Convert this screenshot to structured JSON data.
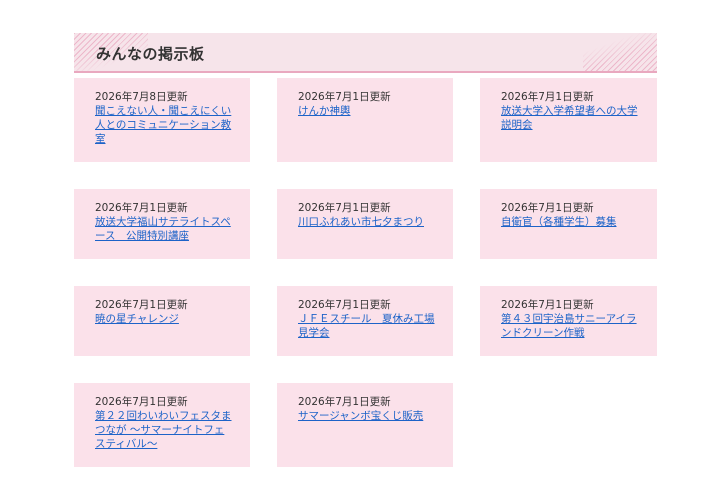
{
  "board": {
    "title": "みんなの掲示板",
    "posts": [
      {
        "date": "2026年7月8日更新",
        "title": "聞こえない人・聞こえにくい人とのコミュニケーション教室"
      },
      {
        "date": "2026年7月1日更新",
        "title": "けんか神輿"
      },
      {
        "date": "2026年7月1日更新",
        "title": "放送大学入学希望者への大学説明会"
      },
      {
        "date": "2026年7月1日更新",
        "title": "放送大学福山サテライトスペース　公開特別講座"
      },
      {
        "date": "2026年7月1日更新",
        "title": "川口ふれあい市七夕まつり"
      },
      {
        "date": "2026年7月1日更新",
        "title": "自衛官（各種学生）募集"
      },
      {
        "date": "2026年7月1日更新",
        "title": "暁の星チャレンジ"
      },
      {
        "date": "2026年7月1日更新",
        "title": "ＪＦＥスチール　夏休み工場見学会"
      },
      {
        "date": "2026年7月1日更新",
        "title": "第４３回宇治島サニーアイランドクリーン作戦"
      },
      {
        "date": "2026年7月1日更新",
        "title": "第２２回わいわいフェスタまつなが ～サマーナイトフェスティバル～"
      },
      {
        "date": "2026年7月1日更新",
        "title": "サマージャンボ宝くじ販売"
      }
    ]
  }
}
